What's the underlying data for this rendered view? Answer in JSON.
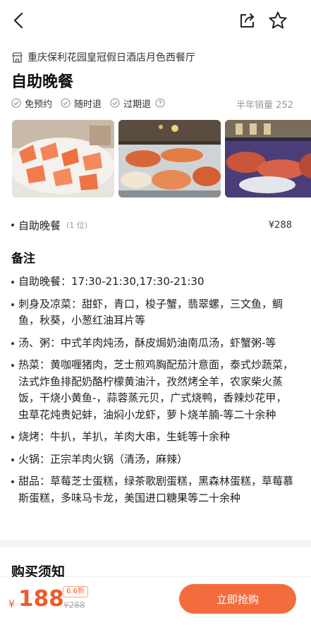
{
  "header": {
    "back_icon": "back-arrow-icon",
    "share_icon": "share-icon",
    "favorite_icon": "star-icon"
  },
  "deal": {
    "hotel_icon": "shop-icon",
    "hotel_name": "重庆保利花园皇冠假日酒店月色西餐厅",
    "title": "自助晚餐",
    "tags": [
      "免预约",
      "随时退",
      "过期退"
    ],
    "help_icon": "question-icon",
    "sales": "半年销量 252"
  },
  "package": {
    "name": "自助晚餐",
    "quantity": "(1 位)",
    "price": "¥288"
  },
  "notes": {
    "title": "备注",
    "items": [
      "自助晚餐：17:30-21:30,17:30-21:30",
      "刺身及凉菜：甜虾，青口，梭子蟹，翡翠螺，三文鱼，鲷鱼，秋葵，小葱红油耳片等",
      "汤、粥：中式羊肉炖汤，酥皮焗奶油南瓜汤，虾蟹粥-等",
      "热菜：黄咖喱猪肉，芝士煎鸡胸配茄汁意面，泰式炒蔬菜，法式炸鱼排配奶酪柠檬黄油汁，孜然烤全羊，农家柴火蒸饭，干烧小黄鱼-，蒜蓉蒸元贝，广式烧鸭，香辣炒花甲，虫草花炖贵妃蚌，油焖小龙虾，萝卜烧羊腩-等二十余种",
      "烧烤：牛扒，羊扒，羊肉大串，生蚝等十余种",
      "火锅：正宗羊肉火锅（清汤，麻辣）",
      "甜品：草莓芝士蛋糕，绿茶歌剧蛋糕，黑森林蛋糕，草莓慕斯蛋糕，多味马卡龙，美国进口糖果等二十余种"
    ]
  },
  "purchase_notice": {
    "title": "购买须知"
  },
  "bottom": {
    "currency": "¥",
    "price": "188",
    "discount": "6.6折",
    "original_price": "¥288",
    "buy_label": "立即抢购"
  },
  "colors": {
    "accent": "#f26c3e",
    "price": "#f05a2a"
  }
}
